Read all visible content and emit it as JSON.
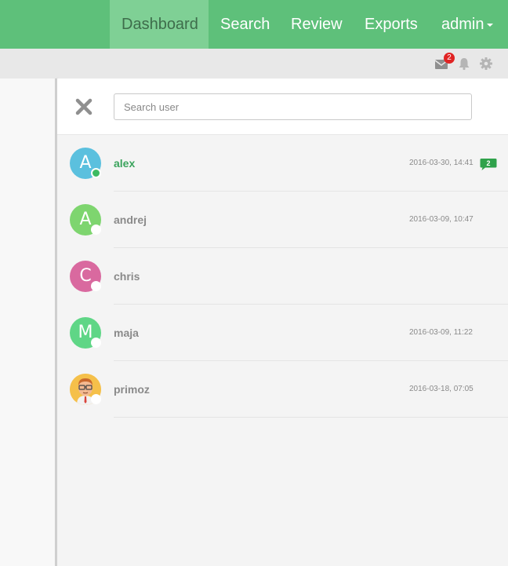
{
  "nav": {
    "items": [
      {
        "label": "Dashboard",
        "active": true
      },
      {
        "label": "Search"
      },
      {
        "label": "Review"
      },
      {
        "label": "Exports"
      },
      {
        "label": "admin"
      }
    ]
  },
  "toolbar": {
    "mail_badge": "2",
    "icons": [
      "envelope-icon",
      "bell-icon",
      "gear-icon"
    ]
  },
  "search": {
    "placeholder": "Search user",
    "value": ""
  },
  "users": [
    {
      "initial": "A",
      "name": "alex",
      "time": "2016-03-30, 14:41",
      "unread": "2",
      "online": true,
      "avatar_color": "#5bc0de",
      "active": true
    },
    {
      "initial": "A",
      "name": "andrej",
      "time": "2016-03-09, 10:47",
      "online": false,
      "avatar_color": "#7ed56f"
    },
    {
      "initial": "C",
      "name": "chris",
      "time": "",
      "online": false,
      "avatar_color": "#d9699f"
    },
    {
      "initial": "M",
      "name": "maja",
      "time": "2016-03-09, 11:22",
      "online": false,
      "avatar_color": "#5fd686"
    },
    {
      "initial": "",
      "name": "primoz",
      "time": "2016-03-18, 07:05",
      "online": false,
      "avatar_type": "cartoon-portrait"
    }
  ],
  "colors": {
    "brand": "#5ec07a",
    "active_nav": "#7fd095",
    "online": "#3dbb62",
    "badge": "#e02424"
  }
}
